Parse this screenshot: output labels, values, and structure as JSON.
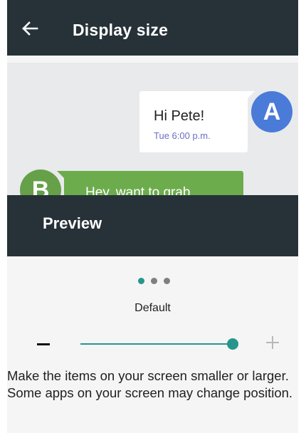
{
  "app_bar": {
    "title": "Display size",
    "back_icon": "arrow-back-icon",
    "background": "#263238"
  },
  "preview": {
    "incoming": {
      "avatar_letter": "A",
      "message": "Hi Pete!",
      "time": "Tue 6:00 p.m.",
      "avatar_color": "#4a7bd8"
    },
    "outgoing": {
      "avatar_letter": "B",
      "message": "Hey, want to grab",
      "bubble_color": "#6cac4c"
    },
    "label": "Preview"
  },
  "size_control": {
    "page_indicator": {
      "count": 3,
      "active_index": 0
    },
    "current_size": "Default",
    "decrease_symbol": "minus-icon",
    "increase_symbol": "plus-icon",
    "slider_level": 1.0,
    "accent": "#26968c"
  },
  "description": "Make the items on your screen smaller or larger. Some apps on your screen may change position."
}
